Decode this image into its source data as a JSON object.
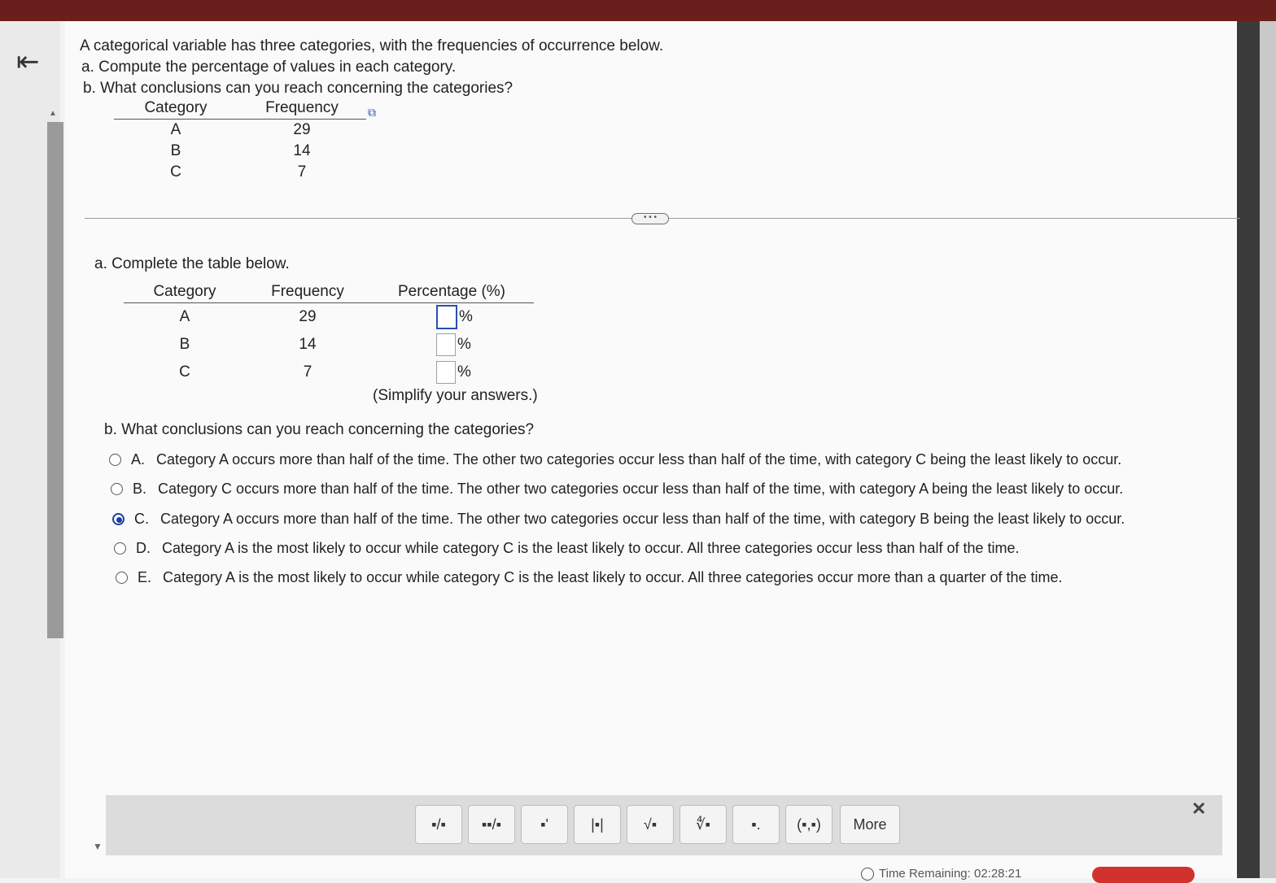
{
  "question": {
    "intro": "A categorical variable has three categories, with the frequencies of occurrence below.",
    "part_a": "a. Compute the percentage of values in each category.",
    "part_b": "b. What conclusions can you reach concerning the categories?"
  },
  "data_table": {
    "headers": [
      "Category",
      "Frequency"
    ],
    "rows": [
      {
        "category": "A",
        "frequency": "29"
      },
      {
        "category": "B",
        "frequency": "14"
      },
      {
        "category": "C",
        "frequency": "7"
      }
    ]
  },
  "divider_more": "• • •",
  "answer_a": {
    "prompt": "a. Complete the table below.",
    "headers": [
      "Category",
      "Frequency",
      "Percentage (%)"
    ],
    "rows": [
      {
        "category": "A",
        "frequency": "29",
        "percentage": "",
        "unit": "%"
      },
      {
        "category": "B",
        "frequency": "14",
        "percentage": "",
        "unit": "%"
      },
      {
        "category": "C",
        "frequency": "7",
        "percentage": "",
        "unit": "%"
      }
    ],
    "note": "(Simplify your answers.)"
  },
  "answer_b": {
    "prompt": "b. What conclusions can you reach concerning the categories?",
    "options": [
      {
        "letter": "A.",
        "text": "Category A occurs more than half of the time. The other two categories occur less than half of the time, with category C being the least likely to occur.",
        "selected": false
      },
      {
        "letter": "B.",
        "text": "Category C occurs more than half of the time. The other two categories occur less than half of the time, with category A being the least likely to occur.",
        "selected": false
      },
      {
        "letter": "C.",
        "text": "Category A occurs more than half of the time. The other two categories occur less than half of the time, with category B being the least likely to occur.",
        "selected": true
      },
      {
        "letter": "D.",
        "text": "Category A is the most likely to occur while category C is the least likely to occur. All three categories occur less than half of the time.",
        "selected": false
      },
      {
        "letter": "E.",
        "text": "Category A is the most likely to occur while category C is the least likely to occur. All three categories occur more than a quarter of the time.",
        "selected": false
      }
    ]
  },
  "palette": {
    "tools": [
      {
        "name": "fraction-icon",
        "glyph": "▪/▪"
      },
      {
        "name": "mixed-number-icon",
        "glyph": "▪▪/▪"
      },
      {
        "name": "exponent-icon",
        "glyph": "▪'"
      },
      {
        "name": "absolute-value-icon",
        "glyph": "|▪|"
      },
      {
        "name": "square-root-icon",
        "glyph": "√▪"
      },
      {
        "name": "nth-root-icon",
        "glyph": "∜▪"
      },
      {
        "name": "decimal-icon",
        "glyph": "▪."
      },
      {
        "name": "ordered-pair-icon",
        "glyph": "(▪,▪)"
      }
    ],
    "more_label": "More",
    "close_glyph": "✕"
  },
  "timer": {
    "label": "Time Remaining: 02:28:21"
  }
}
